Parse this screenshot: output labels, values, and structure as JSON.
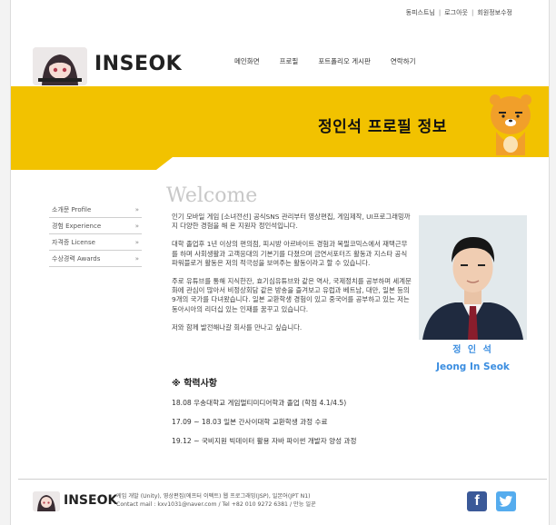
{
  "util_links": [
    "동피스트님",
    "로그아웃",
    "회원정보수정"
  ],
  "logo": {
    "text": "INSEOK"
  },
  "nav": [
    "메인화면",
    "프로필",
    "포트폴리오 게시판",
    "연락하기"
  ],
  "banner": {
    "title": "정인석 프로필 정보",
    "color": "#f2c200"
  },
  "sidebar": [
    {
      "label": "소개문 Profile",
      "arrow": "»"
    },
    {
      "label": "경험 Experience",
      "arrow": "»"
    },
    {
      "label": "자격증 License",
      "arrow": "»"
    },
    {
      "label": "수상경력 Awards",
      "arrow": "»"
    }
  ],
  "main": {
    "welcome": "Welcome",
    "paragraphs": [
      "인기 모바일 게임 [소녀전선] 공식SNS 관리부터 영상편집, 게임제작, UI프로그래밍까지 다양한 경험을 해 온 지원자 정인석입니다.",
      "대학 졸업후 1년 이상의 편의점, 피시방 아르바이트 경험과 복필코믹스에서 재택근무를 하며 사회생활과 고객응대의 기본기를 다졌으며 금연서포터즈 활동과 지스타 공식 파워블로거 활동은 저의 적극성을 보여주는 활동이라고 할 수 있습니다.",
      "주로 유튜브를 통해 지식한잔, 효기심유튜브와 같은 역사, 국제정치를 공부하며 세계문화에 관심이 많아서 비정상회담 같은 방송을 즐겨보고 유럽과 베트남, 대만, 일본 등의 9개의 국가를 다녀왔습니다. 일본 교환학생 경험이 있고 중국어를 공부하고 있는 저는 동아시아의 리더십 있는 인재를 꿈꾸고 있습니다.",
      "저와 함께 발전해나갈 회사를 만나고 싶습니다."
    ],
    "education_heading": "※ 학력사항",
    "education": [
      "18.08 우송대학교 게임멀티미디어학과 졸업 (학점 4.1/4.5)",
      "17.09 ~ 18.03 일본 간사이대학 교환학생 과정 수료",
      "19.12 ~ 국비지원 빅데이터 활용 자바 파이썬 개발자 양성 과정"
    ]
  },
  "profile": {
    "name_ko": "정 인 석",
    "name_en": "Jeong In Seok",
    "accent": "#3a8de0"
  },
  "footer": {
    "logo": "INSEOK",
    "line1": "게임 개발 (Unity), 영상편집(에프터 이펙트) 웹 프로그래밍(JSP), 일본어(JPT N1)",
    "line2": "Contact mail : kxv1031@naver.com / Tel +82 010 9272 6381 / 만능 일꾼",
    "facebook": "f",
    "twitter": "t"
  }
}
